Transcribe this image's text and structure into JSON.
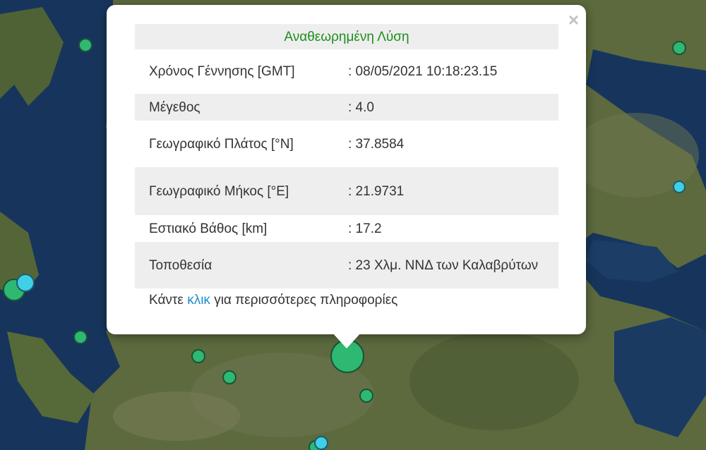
{
  "popup": {
    "close_symbol": "×",
    "title": "Αναθεωρημένη Λύση",
    "rows": [
      {
        "label": "Χρόνος Γέννησης [GMT]",
        "value": ": 08/05/2021 10:18:23.15"
      },
      {
        "label": "Μέγεθος",
        "value": ": 4.0"
      },
      {
        "label": "Γεωγραφικό Πλάτος [°N]",
        "value": ": 37.8584"
      },
      {
        "label": "Γεωγραφικό Μήκος [°E]",
        "value": ": 21.9731"
      },
      {
        "label": "Εστιακό Βάθος [km]",
        "value": ": 17.2"
      },
      {
        "label": "Τοποθεσία",
        "value": ": 23 Χλμ. ΝΝΔ των Καλαβρύτων"
      }
    ],
    "more_prefix": "Κάντε ",
    "more_link": "κλικ",
    "more_suffix": " για περισσότερες πληροφορίες"
  },
  "colors": {
    "title": "#1e8e1e",
    "link": "#1f8fcf",
    "marker_green": "#2eb872",
    "marker_cyan": "#3fd0e6",
    "sea": "#16345a",
    "land": "#5a6840"
  },
  "icons": [
    "close-icon",
    "earthquake-marker"
  ]
}
